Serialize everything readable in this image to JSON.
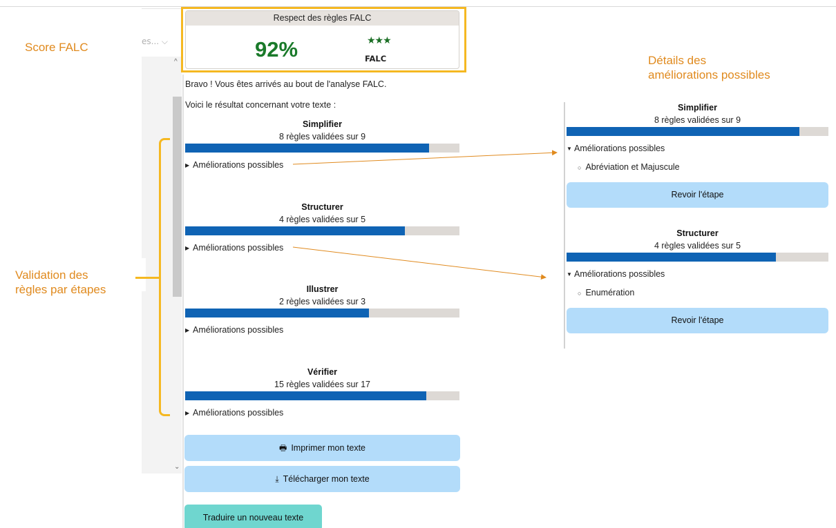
{
  "annotations": {
    "score": "Score FALC",
    "validation_line1": "Validation des",
    "validation_line2": "règles par étapes",
    "details_line1": "Détails des",
    "details_line2": "améliorations possibles"
  },
  "background_app": {
    "dropdown_text": "es... ⌵"
  },
  "score_card": {
    "header": "Respect des règles FALC",
    "percent": "92%",
    "stars": "★★★",
    "label": "FALC"
  },
  "intro": {
    "line1": "Bravo ! Vous êtes arrivés au bout de l'analyse FALC.",
    "line2": "Voici le résultat concernant votre texte :"
  },
  "steps": [
    {
      "title": "Simplifier",
      "count_text": "8 règles validées sur 9",
      "progress": 0.89,
      "improvements_label": "Améliorations possibles"
    },
    {
      "title": "Structurer",
      "count_text": "4 règles validées sur 5",
      "progress": 0.8,
      "improvements_label": "Améliorations possibles"
    },
    {
      "title": "Illustrer",
      "count_text": "2 règles validées sur 3",
      "progress": 0.67,
      "improvements_label": "Améliorations possibles"
    },
    {
      "title": "Vérifier",
      "count_text": "15 règles validées sur 17",
      "progress": 0.88,
      "improvements_label": "Améliorations possibles"
    }
  ],
  "buttons": {
    "print": "Imprimer mon texte",
    "download": "Télécharger mon texte",
    "new_translation": "Traduire un nouveau texte"
  },
  "details": [
    {
      "title": "Simplifier",
      "count_text": "8 règles validées sur 9",
      "progress": 0.89,
      "improvements_label": "Améliorations possibles",
      "items": [
        "Abréviation et Majuscule"
      ],
      "review_button": "Revoir l'étape"
    },
    {
      "title": "Structurer",
      "count_text": "4 règles validées sur 5",
      "progress": 0.8,
      "improvements_label": "Améliorations possibles",
      "items": [
        "Enumération"
      ],
      "review_button": "Revoir l'étape"
    }
  ],
  "colors": {
    "accent_orange": "#e08a1e",
    "highlight_yellow": "#f5b821",
    "progress_blue": "#0f63b4",
    "button_light_blue": "#b3dcfa",
    "button_teal": "#6fd6cf",
    "score_green": "#1a7a2a"
  }
}
